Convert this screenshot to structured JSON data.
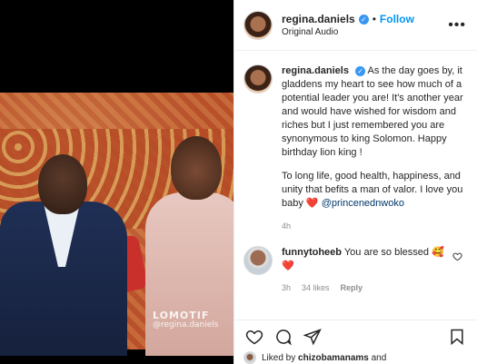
{
  "media": {
    "watermark_brand": "LOMOTIF",
    "watermark_handle": "@regina.daniels"
  },
  "header": {
    "username": "regina.daniels",
    "follow_label": "Follow",
    "separator": "•",
    "audio": "Original Audio",
    "more": "•••"
  },
  "caption": {
    "username": "regina.daniels",
    "text1": "As the day goes by, it gladdens my heart to see how much of a potential leader you are! It's another year and would have wished for wisdom and riches but I just remembered you are synonymous to king Solomon. Happy birthday lion king !",
    "text2": "To long life, good health, happiness, and unity that befits a man of valor. I love you baby",
    "heart": "❤️",
    "mention": "@princenednwoko",
    "time": "4h"
  },
  "comment": {
    "username": "funnytoheeb",
    "text": "You are so blessed",
    "emoji1": "🥰",
    "emoji2": "❤️",
    "time": "3h",
    "likes": "34 likes",
    "reply": "Reply"
  },
  "footer": {
    "liked_prefix": "Liked by",
    "liked_user": "chizobamanams",
    "liked_suffix": "and"
  },
  "colors": {
    "accent": "#0095f6",
    "verified": "#3897f0",
    "heart": "#ed1c24",
    "mention": "#00376b",
    "muted": "#8e8e8e"
  },
  "icons": {
    "verified": "verified-badge-icon",
    "like": "heart-icon",
    "comment": "comment-icon",
    "share": "paper-plane-icon",
    "save": "bookmark-icon",
    "more": "more-options-icon"
  }
}
